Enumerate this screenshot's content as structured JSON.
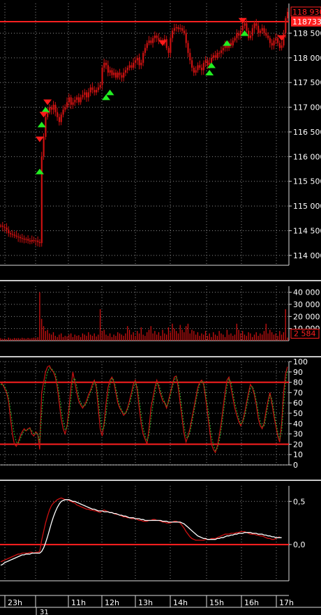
{
  "colors": {
    "background": "#000000",
    "candle": "#cc1111",
    "line_red": "#ff2020",
    "grid": "#8a8a8a",
    "up_marker": "#22ee22",
    "down_marker": "#ff1a1a",
    "stoch_signal": "#2aa82a",
    "macd_signal": "#ffffff",
    "separator": "#c8c8c8"
  },
  "chart_data": [
    {
      "id": "price",
      "type": "candlestick",
      "ylim": [
        113800,
        119100
      ],
      "y_ticks": [
        114000,
        114500,
        115000,
        115500,
        116000,
        116500,
        117000,
        117500,
        118000,
        118500
      ],
      "y_tick_labels": [
        "114 000",
        "114 500",
        "115 000",
        "115 500",
        "116 000",
        "116 500",
        "117 000",
        "117 500",
        "118 000",
        "118 500"
      ],
      "current_price_label": "118733",
      "top_price_label": "118 930",
      "horizontal_level": 118733,
      "close": [
        114600,
        114580,
        114560,
        114520,
        114450,
        114430,
        114420,
        114400,
        114380,
        114370,
        114350,
        114340,
        114320,
        114330,
        114300,
        114280,
        114310,
        114290,
        114300,
        114270,
        114250,
        116000,
        116400,
        116800,
        116900,
        117000,
        116950,
        117050,
        116900,
        116800,
        116700,
        116850,
        116950,
        117000,
        117100,
        117200,
        117050,
        117100,
        117150,
        117200,
        117100,
        117200,
        117250,
        117300,
        117200,
        117300,
        117400,
        117350,
        117300,
        117350,
        117400,
        117450,
        117800,
        117900,
        117850,
        117700,
        117750,
        117650,
        117700,
        117600,
        117700,
        117650,
        117600,
        117700,
        117750,
        117800,
        117850,
        117800,
        117900,
        117950,
        118000,
        117850,
        117900,
        118100,
        118200,
        118300,
        118350,
        118300,
        118400,
        118450,
        118400,
        118350,
        118350,
        118300,
        118380,
        118200,
        118100,
        118400,
        118550,
        118600,
        118620,
        118580,
        118600,
        118550,
        118500,
        118300,
        118100,
        117950,
        117800,
        117700,
        117750,
        117850,
        117800,
        117750,
        117900,
        117950,
        117850,
        117900,
        118000,
        118050,
        118000,
        118100,
        118100,
        118150,
        118200,
        118250,
        118200,
        118300,
        118250,
        118350,
        118400,
        118500,
        118450,
        118550,
        118650,
        118700,
        118550,
        118400,
        118450,
        118600,
        118700,
        118650,
        118500,
        118550,
        118600,
        118500,
        118450,
        118400,
        118300,
        118250,
        118350,
        118400,
        118300,
        118200,
        118250,
        118500,
        118800,
        118930
      ],
      "buy_signals": [
        [
          20,
          115700
        ],
        [
          21,
          116650
        ],
        [
          23,
          116950
        ],
        [
          54,
          117200
        ],
        [
          56,
          117300
        ],
        [
          107,
          117700
        ],
        [
          108,
          117850
        ],
        [
          116,
          118300
        ],
        [
          125,
          118500
        ]
      ],
      "sell_signals": [
        [
          20,
          116350
        ],
        [
          22,
          116850
        ],
        [
          24,
          117100
        ],
        [
          83,
          118300
        ],
        [
          124,
          118750
        ],
        [
          144,
          118400
        ]
      ]
    },
    {
      "id": "volume",
      "type": "bar",
      "ylim": [
        0,
        45000
      ],
      "y_ticks": [
        10000,
        20000,
        30000,
        40000
      ],
      "y_tick_labels": [
        "10 000",
        "20 000",
        "30 000",
        "40 000"
      ],
      "current_value_label": "2 584",
      "values": [
        2000,
        1500,
        1800,
        1200,
        2500,
        1800,
        1500,
        2200,
        1900,
        2100,
        1700,
        2400,
        2000,
        1600,
        2300,
        1800,
        2100,
        2500,
        2200,
        2800,
        40000,
        18000,
        12000,
        8000,
        9000,
        6000,
        5000,
        7000,
        4000,
        3000,
        5000,
        6000,
        3000,
        4000,
        3500,
        5000,
        6000,
        3000,
        5000,
        4000,
        4500,
        3000,
        6000,
        5000,
        4000,
        7000,
        5000,
        4000,
        6000,
        3500,
        5000,
        26000,
        8000,
        9000,
        5000,
        4000,
        6000,
        3000,
        5000,
        4000,
        7000,
        6000,
        5000,
        4000,
        6000,
        12000,
        9000,
        5000,
        7000,
        4000,
        8000,
        6000,
        11000,
        5000,
        4000,
        7000,
        9000,
        12000,
        6000,
        8000,
        5000,
        7000,
        4000,
        9000,
        6000,
        5000,
        11000,
        7000,
        14000,
        10000,
        8000,
        6000,
        13000,
        9000,
        7000,
        12000,
        14000,
        6000,
        9000,
        8000,
        5000,
        7000,
        4000,
        6000,
        5000,
        8000,
        4000,
        6000,
        3000,
        7000,
        5000,
        4000,
        8000,
        6000,
        5000,
        3000,
        9000,
        5000,
        6000,
        4000,
        5000,
        14000,
        9000,
        6000,
        8000,
        5000,
        4000,
        7000,
        6000,
        3000,
        5000,
        7000,
        4000,
        6000,
        5000,
        8000,
        14000,
        6000,
        9000,
        7000,
        5000,
        6000,
        4000,
        8000,
        5000,
        7000,
        26000,
        2584
      ]
    },
    {
      "id": "stochastic",
      "type": "line",
      "ylim": [
        0,
        100
      ],
      "y_ticks": [
        0,
        10,
        20,
        30,
        40,
        50,
        60,
        70,
        80,
        90,
        100
      ],
      "y_tick_labels": [
        "0",
        "10",
        "20",
        "30",
        "40",
        "50",
        "60",
        "70",
        "80",
        "90",
        "100"
      ],
      "levels": [
        20,
        80
      ],
      "series": [
        {
          "values": [
            80,
            78,
            74,
            70,
            62,
            45,
            30,
            20,
            18,
            22,
            28,
            32,
            35,
            33,
            35,
            36,
            30,
            28,
            32,
            30,
            15,
            70,
            80,
            90,
            95,
            96,
            92,
            90,
            85,
            75,
            60,
            45,
            35,
            30,
            38,
            55,
            75,
            90,
            80,
            70,
            62,
            58,
            55,
            58,
            62,
            68,
            72,
            78,
            82,
            75,
            55,
            35,
            28,
            40,
            60,
            75,
            82,
            85,
            80,
            70,
            60,
            55,
            52,
            48,
            50,
            55,
            62,
            70,
            78,
            82,
            72,
            55,
            40,
            30,
            25,
            20,
            35,
            55,
            65,
            75,
            82,
            75,
            68,
            62,
            60,
            55,
            62,
            70,
            78,
            85,
            86,
            75,
            60,
            45,
            30,
            22,
            28,
            35,
            45,
            55,
            65,
            75,
            80,
            82,
            78,
            65,
            50,
            35,
            20,
            15,
            12,
            18,
            28,
            40,
            55,
            70,
            82,
            85,
            75,
            65,
            55,
            48,
            42,
            38,
            42,
            50,
            60,
            70,
            78,
            75,
            68,
            58,
            45,
            38,
            35,
            40,
            52,
            62,
            70,
            60,
            48,
            38,
            28,
            22,
            40,
            70,
            88,
            95
          ]
        },
        {
          "values": [
            78,
            78,
            76,
            72,
            66,
            53,
            40,
            30,
            22,
            21,
            25,
            30,
            33,
            34,
            34,
            35,
            33,
            30,
            31,
            30,
            22,
            50,
            68,
            82,
            90,
            94,
            93,
            91,
            88,
            80,
            68,
            54,
            42,
            34,
            36,
            48,
            64,
            82,
            84,
            76,
            66,
            60,
            57,
            57,
            60,
            65,
            70,
            75,
            80,
            78,
            64,
            46,
            34,
            36,
            50,
            66,
            78,
            84,
            82,
            74,
            64,
            57,
            53,
            50,
            50,
            53,
            59,
            66,
            74,
            80,
            76,
            63,
            48,
            36,
            28,
            23,
            29,
            44,
            58,
            70,
            79,
            78,
            71,
            65,
            61,
            57,
            60,
            67,
            75,
            82,
            85,
            80,
            67,
            52,
            38,
            27,
            26,
            32,
            41,
            51,
            61,
            71,
            78,
            81,
            80,
            70,
            57,
            42,
            28,
            19,
            14,
            16,
            23,
            34,
            48,
            63,
            76,
            83,
            80,
            70,
            60,
            52,
            45,
            40,
            41,
            47,
            56,
            66,
            75,
            76,
            71,
            62,
            51,
            42,
            37,
            38,
            47,
            58,
            67,
            64,
            53,
            42,
            32,
            25,
            33,
            58,
            80,
            92
          ]
        }
      ]
    },
    {
      "id": "macd",
      "type": "line",
      "ylim": [
        -0.42,
        0.68
      ],
      "y_ticks": [
        0.0,
        0.5
      ],
      "y_tick_labels": [
        "0,0",
        "0,5"
      ],
      "levels": [
        0.0
      ],
      "series": [
        {
          "values": [
            -0.2,
            -0.19,
            -0.18,
            -0.17,
            -0.16,
            -0.15,
            -0.14,
            -0.13,
            -0.12,
            -0.11,
            -0.11,
            -0.1,
            -0.1,
            -0.1,
            -0.1,
            -0.09,
            -0.09,
            -0.1,
            -0.09,
            -0.09,
            -0.08,
            0.05,
            0.15,
            0.25,
            0.33,
            0.4,
            0.45,
            0.48,
            0.5,
            0.52,
            0.53,
            0.54,
            0.53,
            0.52,
            0.52,
            0.51,
            0.5,
            0.49,
            0.48,
            0.46,
            0.45,
            0.44,
            0.43,
            0.42,
            0.41,
            0.41,
            0.4,
            0.4,
            0.39,
            0.39,
            0.38,
            0.37,
            0.39,
            0.4,
            0.39,
            0.38,
            0.37,
            0.37,
            0.36,
            0.35,
            0.35,
            0.34,
            0.33,
            0.32,
            0.32,
            0.31,
            0.31,
            0.3,
            0.3,
            0.3,
            0.29,
            0.28,
            0.28,
            0.27,
            0.27,
            0.27,
            0.28,
            0.28,
            0.29,
            0.29,
            0.28,
            0.28,
            0.27,
            0.26,
            0.26,
            0.25,
            0.25,
            0.25,
            0.26,
            0.27,
            0.27,
            0.26,
            0.25,
            0.22,
            0.19,
            0.15,
            0.12,
            0.09,
            0.07,
            0.06,
            0.05,
            0.05,
            0.05,
            0.05,
            0.05,
            0.06,
            0.06,
            0.06,
            0.07,
            0.07,
            0.07,
            0.08,
            0.09,
            0.1,
            0.11,
            0.12,
            0.12,
            0.12,
            0.13,
            0.13,
            0.13,
            0.14,
            0.14,
            0.15,
            0.15,
            0.15,
            0.14,
            0.13,
            0.12,
            0.12,
            0.12,
            0.11,
            0.11,
            0.1,
            0.1,
            0.09,
            0.08,
            0.07,
            0.07,
            0.06,
            0.06,
            0.07,
            0.08,
            0.09
          ]
        },
        {
          "values": [
            -0.24,
            -0.23,
            -0.21,
            -0.2,
            -0.19,
            -0.18,
            -0.17,
            -0.16,
            -0.15,
            -0.14,
            -0.13,
            -0.12,
            -0.12,
            -0.11,
            -0.11,
            -0.11,
            -0.1,
            -0.1,
            -0.1,
            -0.1,
            -0.1,
            -0.08,
            -0.04,
            0.02,
            0.09,
            0.17,
            0.25,
            0.32,
            0.38,
            0.43,
            0.47,
            0.5,
            0.51,
            0.52,
            0.52,
            0.52,
            0.51,
            0.5,
            0.5,
            0.49,
            0.48,
            0.47,
            0.46,
            0.45,
            0.44,
            0.43,
            0.42,
            0.41,
            0.41,
            0.4,
            0.39,
            0.39,
            0.39,
            0.38,
            0.38,
            0.38,
            0.37,
            0.37,
            0.36,
            0.36,
            0.35,
            0.34,
            0.34,
            0.33,
            0.33,
            0.32,
            0.31,
            0.31,
            0.31,
            0.3,
            0.3,
            0.3,
            0.29,
            0.29,
            0.28,
            0.28,
            0.28,
            0.28,
            0.28,
            0.28,
            0.28,
            0.28,
            0.28,
            0.27,
            0.27,
            0.27,
            0.26,
            0.26,
            0.26,
            0.26,
            0.26,
            0.26,
            0.26,
            0.25,
            0.24,
            0.22,
            0.2,
            0.18,
            0.16,
            0.14,
            0.12,
            0.1,
            0.09,
            0.08,
            0.07,
            0.07,
            0.06,
            0.06,
            0.06,
            0.06,
            0.06,
            0.07,
            0.07,
            0.08,
            0.08,
            0.09,
            0.1,
            0.1,
            0.11,
            0.11,
            0.12,
            0.12,
            0.13,
            0.13,
            0.13,
            0.14,
            0.14,
            0.14,
            0.14,
            0.13,
            0.13,
            0.13,
            0.12,
            0.12,
            0.12,
            0.11,
            0.11,
            0.1,
            0.1,
            0.09,
            0.09,
            0.08,
            0.08,
            0.08,
            0.08
          ]
        }
      ]
    },
    {
      "id": "time_axis",
      "type": "axis",
      "x_tick_positions": [
        7,
        51,
        98,
        146,
        194,
        244,
        296,
        346,
        396
      ],
      "x_tick_labels": [
        "23h",
        "",
        "11h",
        "12h",
        "13h",
        "14h",
        "15h",
        "16h",
        "17h"
      ],
      "date_label_position": 52,
      "date_label": "31"
    }
  ]
}
